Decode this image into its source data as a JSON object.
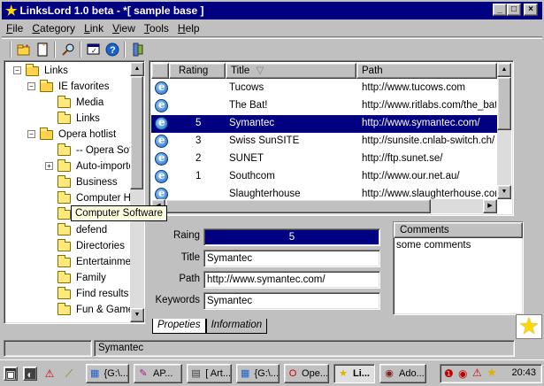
{
  "window": {
    "title": "LinksLord 1.0 beta - *[ sample base ]",
    "controls": {
      "minimize": "_",
      "maximize": "□",
      "close": "×"
    }
  },
  "menu": [
    {
      "label": "File",
      "key": "F",
      "rest": "ile"
    },
    {
      "label": "Category",
      "key": "C",
      "rest": "ategory"
    },
    {
      "label": "Link",
      "key": "L",
      "rest": "ink"
    },
    {
      "label": "View",
      "key": "V",
      "rest": "iew"
    },
    {
      "label": "Tools",
      "key": "T",
      "rest": "ools"
    },
    {
      "label": "Help",
      "key": "H",
      "rest": "elp"
    }
  ],
  "toolbar": {
    "icons": [
      "new-folder-icon",
      "new-document-icon",
      "find-icon",
      "properties-icon",
      "help-icon",
      "plugin-icon"
    ]
  },
  "tree": {
    "nodes": [
      {
        "label": "Links",
        "depth": 0,
        "open": true,
        "expander": "-"
      },
      {
        "label": "IE favorites",
        "depth": 1,
        "open": true,
        "expander": "-"
      },
      {
        "label": "Media",
        "depth": 2,
        "open": false,
        "expander": ""
      },
      {
        "label": "Links",
        "depth": 2,
        "open": false,
        "expander": ""
      },
      {
        "label": "Opera hotlist",
        "depth": 1,
        "open": true,
        "expander": "-"
      },
      {
        "label": "-- Opera Soft",
        "depth": 2,
        "open": false,
        "expander": ""
      },
      {
        "label": "Auto-importe",
        "depth": 2,
        "open": false,
        "expander": "+"
      },
      {
        "label": "Business",
        "depth": 2,
        "open": false,
        "expander": ""
      },
      {
        "label": "Computer Ha",
        "depth": 2,
        "open": false,
        "expander": ""
      },
      {
        "label": "Computer Software",
        "depth": 2,
        "open": false,
        "expander": ""
      },
      {
        "label": "defend",
        "depth": 2,
        "open": false,
        "expander": ""
      },
      {
        "label": "Directories",
        "depth": 2,
        "open": false,
        "expander": ""
      },
      {
        "label": "Entertainmer",
        "depth": 2,
        "open": false,
        "expander": ""
      },
      {
        "label": "Family",
        "depth": 2,
        "open": false,
        "expander": ""
      },
      {
        "label": "Find results",
        "depth": 2,
        "open": false,
        "expander": ""
      },
      {
        "label": "Fun & Game:",
        "depth": 2,
        "open": false,
        "expander": ""
      }
    ],
    "tooltip": "Computer Software"
  },
  "list": {
    "columns": {
      "rating": "Rating",
      "title": "Title",
      "sort_glyph": "▽",
      "path": "Path"
    },
    "rows": [
      {
        "rating": "",
        "title": "Tucows",
        "path": "http://www.tucows.com",
        "selected": false
      },
      {
        "rating": "",
        "title": "The Bat!",
        "path": "http://www.ritlabs.com/the_bat/ind",
        "selected": false
      },
      {
        "rating": "5",
        "title": "Symantec",
        "path": "http://www.symantec.com/",
        "selected": true
      },
      {
        "rating": "3",
        "title": "Swiss SunSITE",
        "path": "http://sunsite.cnlab-switch.ch/",
        "selected": false
      },
      {
        "rating": "2",
        "title": "SUNET",
        "path": "http://ftp.sunet.se/",
        "selected": false
      },
      {
        "rating": "1",
        "title": "Southcom",
        "path": "http://www.our.net.au/",
        "selected": false
      },
      {
        "rating": "",
        "title": "Slaughterhouse",
        "path": "http://www.slaughterhouse.com/",
        "selected": false
      }
    ]
  },
  "properties": {
    "rating_label": "Raing",
    "rating_value": "5",
    "title_label": "Title",
    "title_value": "Symantec",
    "path_label": "Path",
    "path_value": "http://www.symantec.com/",
    "keywords_label": "Keywords",
    "keywords_value": "Symantec"
  },
  "comments": {
    "header": "Comments",
    "text": "some comments"
  },
  "tabs": {
    "properties": "Propeties",
    "information": "Information"
  },
  "status": {
    "text": "Symantec"
  },
  "taskbar": {
    "tasks": [
      {
        "label": "{G:\\...",
        "icon": "window-icon"
      },
      {
        "label": "AP...",
        "icon": "pen-icon"
      },
      {
        "label": "[ Art...",
        "icon": "document-icon"
      },
      {
        "label": "{G:\\...",
        "icon": "window-icon"
      },
      {
        "label": "Ope...",
        "icon": "opera-icon"
      },
      {
        "label": "Li...",
        "icon": "star-icon"
      },
      {
        "label": "Ado...",
        "icon": "eye-icon"
      }
    ],
    "clock": "20:43"
  },
  "colors": {
    "selection": "#000080",
    "face": "#c0c0c0",
    "desktop": "#008080",
    "star": "#ffd800"
  }
}
